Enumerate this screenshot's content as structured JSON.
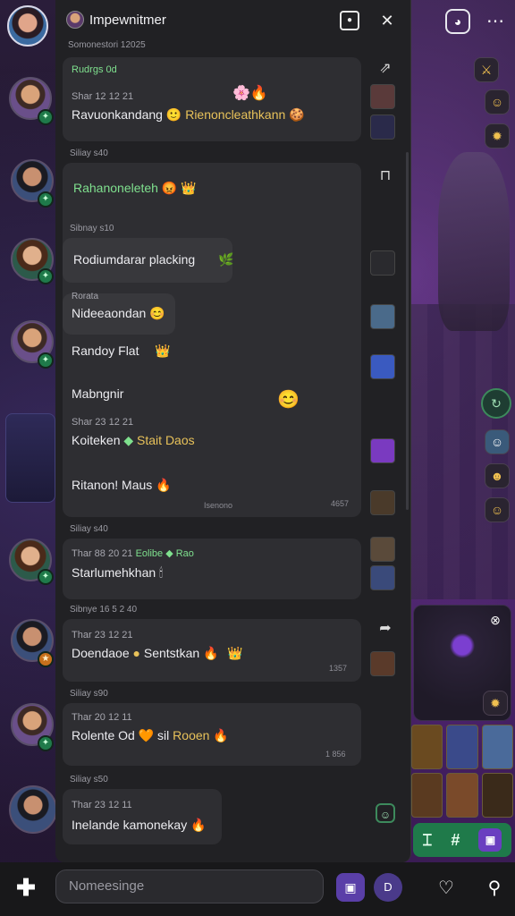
{
  "header": {
    "title": "Impewnitmer",
    "date": "Somonestori 12025"
  },
  "messages": [
    {
      "section": "",
      "meta_green": "Rudrgs 0d",
      "meta": "Shar 12 12 21",
      "text": "Ravuonkandang",
      "text2": "Rienoncleathkann",
      "emoji": "🙂",
      "emoji2": "🍪"
    },
    {
      "section": "Siliay s40",
      "text": "Rahanoneleteh",
      "emoji": "😡",
      "emoji2": "👑"
    },
    {
      "section": "Sibnay s10",
      "text": "Rodiumdarar placking",
      "emoji": "🌿"
    }
  ],
  "long_block": {
    "name1": "Rorata",
    "text1": "Nideeaondan",
    "text2": "Randoy Flat",
    "text3": "Mabngnir",
    "meta": "Shar 23 12 21",
    "text4a": "Koiteken",
    "text4b": "Stait Daos",
    "text5": "Ritanon! Maus",
    "footer_left": "Isenono",
    "footer_right": "4657"
  },
  "messages2": [
    {
      "section": "Siliay s40",
      "meta": "Thar 88 20 21",
      "meta_green": "Eolibe",
      "meta_green2": "Rao",
      "text": "Starlumehkhan",
      "emoji": "🕯"
    },
    {
      "section": "Sibnye 16 5 2 40",
      "meta": "Thar 23 12 21",
      "text": "Doendaoe",
      "text2": "Sentstkan",
      "emoji": "👑",
      "time": "1357"
    },
    {
      "section": "Siliay s90",
      "meta": "Thar 20 12 11",
      "text": "Rolente Od",
      "text2": "sil",
      "text3": "Rooen",
      "time": "1 856"
    },
    {
      "section": "Siliay s50",
      "meta": "Thar 23 12 11",
      "text": "Inelande kamonekay",
      "emoji": "🔥"
    }
  ],
  "composer": {
    "placeholder": "Nomeesinge"
  },
  "icons": {
    "close": "close-icon",
    "share": "share-icon",
    "add": "add-icon",
    "heart": "heart-icon",
    "profile": "profile-icon"
  },
  "colors": {
    "accent_green": "#1f7a4a",
    "accent_purple": "#5a3fa8",
    "panel": "#212124",
    "bubble": "#2e2e32"
  }
}
